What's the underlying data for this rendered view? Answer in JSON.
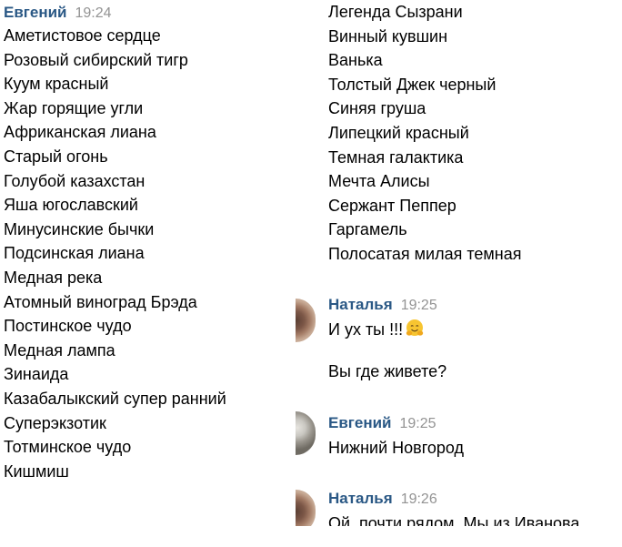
{
  "left_message": {
    "author": "Евгений",
    "time": "19:24",
    "items": [
      "Аметистовое сердце",
      "Розовый сибирский тигр",
      "Куум красный",
      "Жар горящие угли",
      "Африканская лиана",
      "Старый огонь",
      "Голубой казахстан",
      "Яша югославский",
      "Минусинские бычки",
      "Подсинская лиана",
      "Медная река",
      "Атомный виноград Брэда",
      "Постинское чудо",
      "Медная лампа",
      "Зинаида",
      "Казабалыкский супер ранний",
      "Суперэкзотик",
      "Тотминское чудо",
      "Кишмиш"
    ]
  },
  "right_list": {
    "items": [
      "Легенда Сызрани",
      "Винный кувшин",
      "Ванька",
      "Толстый Джек черный",
      "Синяя груша",
      "Липецкий красный",
      "Темная галактика",
      "Мечта Алисы",
      "Сержант Пеппер",
      "Гаргамель",
      "Полосатая милая темная"
    ]
  },
  "message_natalia_1": {
    "author": "Наталья",
    "time": "19:25",
    "line1": "И ух ты !!!",
    "emoji_icon": "hugging-face-icon",
    "line2": "Вы где живете?"
  },
  "message_evgeny_2": {
    "author": "Евгений",
    "time": "19:25",
    "text": "Нижний Новгород"
  },
  "message_natalia_2": {
    "author": "Наталья",
    "time": "19:26",
    "text": "Ой, почти рядом. Мы из Иванова"
  },
  "colors": {
    "author": "#2a5885",
    "time": "#939393",
    "text": "#000000",
    "background": "#ffffff"
  }
}
